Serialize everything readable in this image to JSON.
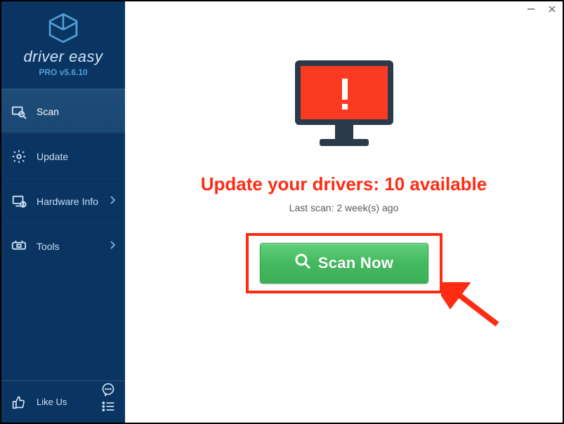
{
  "app": {
    "brand_prefix": "driver ",
    "brand_suffix": "easy",
    "version_label": "PRO v5.6.10"
  },
  "sidebar": {
    "items": [
      {
        "id": "scan",
        "label": "Scan",
        "icon": "scan-icon",
        "active": true,
        "has_chevron": false
      },
      {
        "id": "update",
        "label": "Update",
        "icon": "gear-icon",
        "active": false,
        "has_chevron": false
      },
      {
        "id": "hardware-info",
        "label": "Hardware Info",
        "icon": "hardware-icon",
        "active": false,
        "has_chevron": true
      },
      {
        "id": "tools",
        "label": "Tools",
        "icon": "tools-icon",
        "active": false,
        "has_chevron": true
      }
    ],
    "like_us_label": "Like Us"
  },
  "main": {
    "headline": "Update your drivers: 10 available",
    "last_scan_label": "Last scan: 2 week(s) ago",
    "scan_button_label": "Scan Now"
  },
  "colors": {
    "accent_red": "#ff2c14",
    "scan_green": "#44b95f",
    "sidebar_bg": "#0a3461"
  }
}
